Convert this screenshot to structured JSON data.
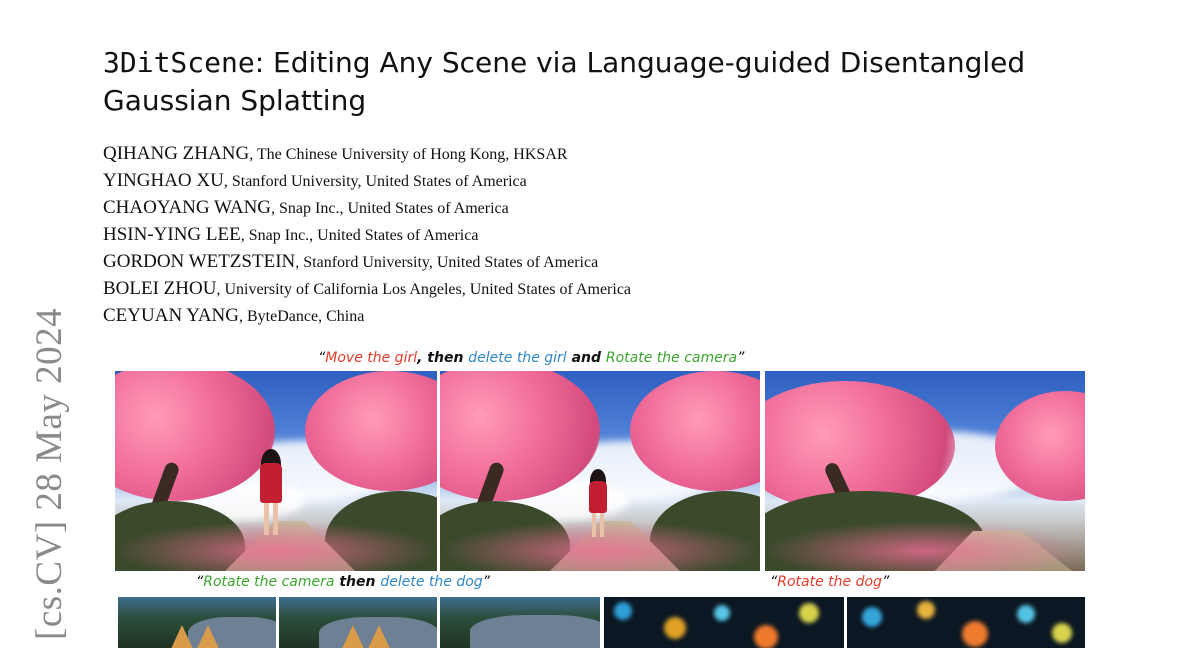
{
  "side_stamp": "[cs.CV]  28 May 2024",
  "title": {
    "line1_mono": "3DitScene",
    "line1_rest": ": Editing Any Scene via Language-guided Disentangled",
    "line2": "Gaussian Splatting"
  },
  "authors": [
    {
      "name": "QIHANG ZHANG",
      "aff": ", The Chinese University of Hong Kong, HKSAR"
    },
    {
      "name": "YINGHAO XU",
      "aff": ", Stanford University, United States of America"
    },
    {
      "name": "CHAOYANG WANG",
      "aff": ", Snap Inc., United States of America"
    },
    {
      "name": "HSIN-YING LEE",
      "aff": ", Snap Inc., United States of America"
    },
    {
      "name": "GORDON WETZSTEIN",
      "aff": ", Stanford University, United States of America"
    },
    {
      "name": "BOLEI ZHOU",
      "aff": ", University of California Los Angeles, United States of America"
    },
    {
      "name": "CEYUAN YANG",
      "aff": ", ByteDance, China"
    }
  ],
  "captions": {
    "top": {
      "q1": "“",
      "p1": "Move the girl",
      "p2": ", then ",
      "p3": "delete the girl",
      "p4": " and ",
      "p5": "Rotate the camera",
      "q2": "”"
    },
    "bottom_left": {
      "q1": "“",
      "p1": "Rotate the camera",
      "p2": " then ",
      "p3": "delete the dog",
      "q2": "”"
    },
    "bottom_right": {
      "q1": "“",
      "p1": "Rotate the dog",
      "q2": "”"
    }
  },
  "colors": {
    "red": "#e53b2a",
    "blue": "#2f86c8",
    "green": "#3aa52c",
    "stamp_gray": "#8a8a8a"
  }
}
